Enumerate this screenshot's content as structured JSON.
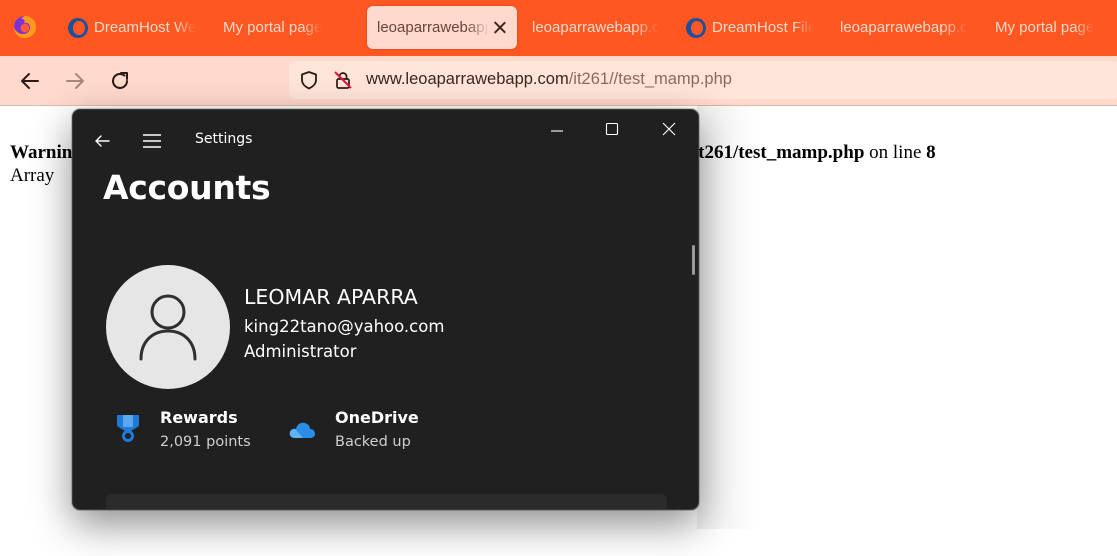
{
  "browser": {
    "tabs": [
      {
        "label": "DreamHost Web",
        "icon": "dreamhost-icon",
        "active": false
      },
      {
        "label": "My portal page",
        "icon": "",
        "active": false
      },
      {
        "label": "leoaparrawebapp",
        "icon": "",
        "active": true
      },
      {
        "label": "leoaparrawebapp.c",
        "icon": "",
        "active": false
      },
      {
        "label": "DreamHost File",
        "icon": "dreamhost-icon",
        "active": false
      },
      {
        "label": "leoaparrawebapp.c",
        "icon": "",
        "active": false
      },
      {
        "label": "My portal page",
        "icon": "",
        "active": false
      }
    ],
    "url": {
      "domain": "www.leoaparrawebapp.com",
      "path": "/it261//test_mamp.php"
    },
    "colors": {
      "tabstrip": "#fe5722",
      "navbar": "#ffd9cc",
      "active_tab": "#ffd9cc"
    }
  },
  "page": {
    "warning_prefix": "Warnin",
    "warning_file": "n/it261/test_mamp.php",
    "warning_online": "on line",
    "warning_line": "8",
    "array_text": "Array"
  },
  "settings_window": {
    "app_title": "Settings",
    "heading": "Accounts",
    "user": {
      "name": "LEOMAR APARRA",
      "email": "king22tano@yahoo.com",
      "role": "Administrator"
    },
    "services": [
      {
        "title": "Rewards",
        "subtitle": "2,091 points",
        "icon": "rewards-medal-icon"
      },
      {
        "title": "OneDrive",
        "subtitle": "Backed up",
        "icon": "onedrive-cloud-icon"
      }
    ],
    "colors": {
      "background": "#202020",
      "rewards_blue": "#1f7ad6",
      "onedrive_blue": "#2a8ee8"
    }
  }
}
